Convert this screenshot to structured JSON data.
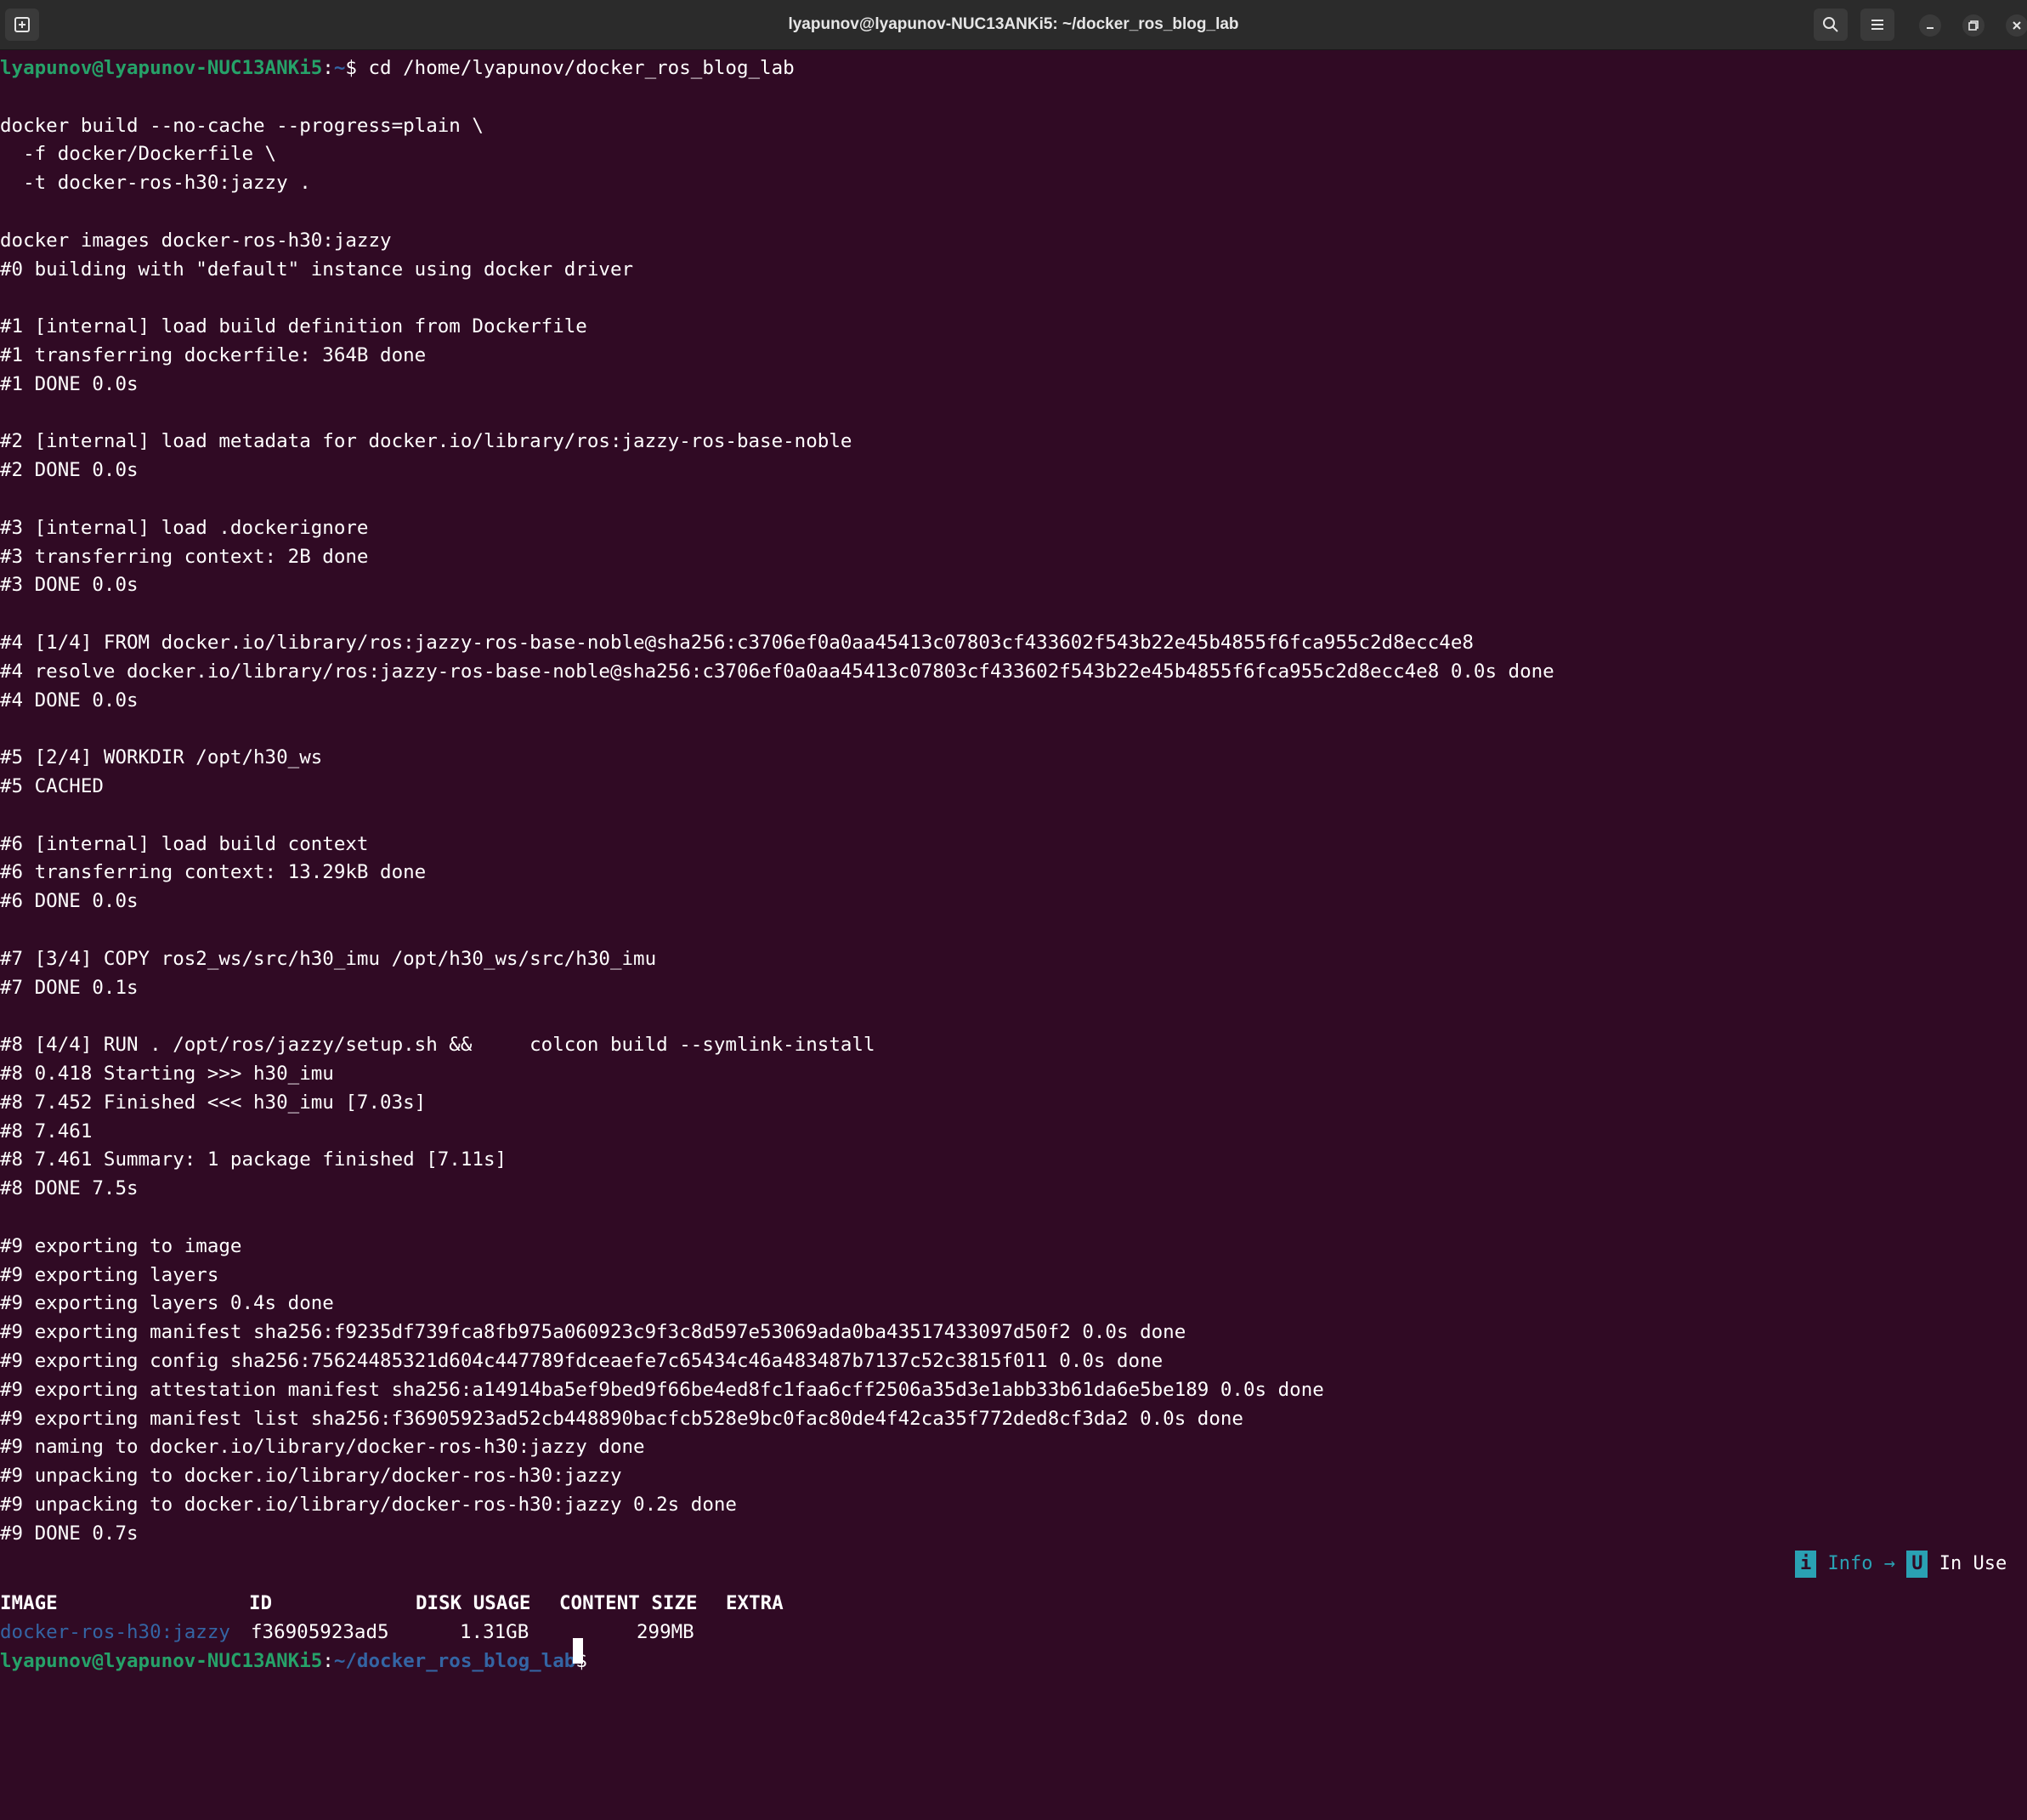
{
  "window": {
    "title": "lyapunov@lyapunov-NUC13ANKi5: ~/docker_ros_blog_lab",
    "icons": [
      "new-tab-icon",
      "search-icon",
      "hamburger-menu-icon",
      "minimize-icon",
      "restore-icon",
      "close-icon"
    ]
  },
  "prompt": {
    "user": "lyapunov@lyapunov-NUC13ANKi5",
    "sep": ":",
    "path_first": "~",
    "path_last": "~/docker_ros_blog_lab",
    "dollar": "$"
  },
  "lines": [
    {
      "row": 1,
      "text": " cd /home/lyapunov/docker_ros_blog_lab",
      "type": "prompt"
    },
    {
      "row": 3,
      "text": "docker build --no-cache --progress=plain \\"
    },
    {
      "row": 4,
      "text": "  -f docker/Dockerfile \\"
    },
    {
      "row": 5,
      "text": "  -t docker-ros-h30:jazzy ."
    },
    {
      "row": 7,
      "text": "docker images docker-ros-h30:jazzy"
    },
    {
      "row": 8,
      "text": "#0 building with \"default\" instance using docker driver"
    },
    {
      "row": 10,
      "text": "#1 [internal] load build definition from Dockerfile"
    },
    {
      "row": 11,
      "text": "#1 transferring dockerfile: 364B done"
    },
    {
      "row": 12,
      "text": "#1 DONE 0.0s"
    },
    {
      "row": 14,
      "text": "#2 [internal] load metadata for docker.io/library/ros:jazzy-ros-base-noble"
    },
    {
      "row": 15,
      "text": "#2 DONE 0.0s"
    },
    {
      "row": 17,
      "text": "#3 [internal] load .dockerignore"
    },
    {
      "row": 18,
      "text": "#3 transferring context: 2B done"
    },
    {
      "row": 19,
      "text": "#3 DONE 0.0s"
    },
    {
      "row": 21,
      "text": "#4 [1/4] FROM docker.io/library/ros:jazzy-ros-base-noble@sha256:c3706ef0a0aa45413c07803cf433602f543b22e45b4855f6fca955c2d8ecc4e8"
    },
    {
      "row": 22,
      "text": "#4 resolve docker.io/library/ros:jazzy-ros-base-noble@sha256:c3706ef0a0aa45413c07803cf433602f543b22e45b4855f6fca955c2d8ecc4e8 0.0s done"
    },
    {
      "row": 23,
      "text": "#4 DONE 0.0s"
    },
    {
      "row": 25,
      "text": "#5 [2/4] WORKDIR /opt/h30_ws"
    },
    {
      "row": 26,
      "text": "#5 CACHED"
    },
    {
      "row": 28,
      "text": "#6 [internal] load build context"
    },
    {
      "row": 29,
      "text": "#6 transferring context: 13.29kB done"
    },
    {
      "row": 30,
      "text": "#6 DONE 0.0s"
    },
    {
      "row": 32,
      "text": "#7 [3/4] COPY ros2_ws/src/h30_imu /opt/h30_ws/src/h30_imu"
    },
    {
      "row": 33,
      "text": "#7 DONE 0.1s"
    },
    {
      "row": 35,
      "text": "#8 [4/4] RUN . /opt/ros/jazzy/setup.sh &&     colcon build --symlink-install"
    },
    {
      "row": 36,
      "text": "#8 0.418 Starting >>> h30_imu"
    },
    {
      "row": 37,
      "text": "#8 7.452 Finished <<< h30_imu [7.03s]"
    },
    {
      "row": 38,
      "text": "#8 7.461"
    },
    {
      "row": 39,
      "text": "#8 7.461 Summary: 1 package finished [7.11s]"
    },
    {
      "row": 40,
      "text": "#8 DONE 7.5s"
    },
    {
      "row": 42,
      "text": "#9 exporting to image"
    },
    {
      "row": 43,
      "text": "#9 exporting layers"
    },
    {
      "row": 44,
      "text": "#9 exporting layers 0.4s done"
    },
    {
      "row": 45,
      "text": "#9 exporting manifest sha256:f9235df739fca8fb975a060923c9f3c8d597e53069ada0ba43517433097d50f2 0.0s done"
    },
    {
      "row": 46,
      "text": "#9 exporting config sha256:75624485321d604c447789fdceaefe7c65434c46a483487b7137c52c3815f011 0.0s done"
    },
    {
      "row": 47,
      "text": "#9 exporting attestation manifest sha256:a14914ba5ef9bed9f66be4ed8fc1faa6cff2506a35d3e1abb33b61da6e5be189 0.0s done"
    },
    {
      "row": 48,
      "text": "#9 exporting manifest list sha256:f36905923ad52cb448890bacfcb528e9bc0fac80de4f42ca35f772ded8cf3da2 0.0s done"
    },
    {
      "row": 49,
      "text": "#9 naming to docker.io/library/docker-ros-h30:jazzy done"
    },
    {
      "row": 50,
      "text": "#9 unpacking to docker.io/library/docker-ros-h30:jazzy"
    },
    {
      "row": 51,
      "text": "#9 unpacking to docker.io/library/docker-ros-h30:jazzy 0.2s done"
    },
    {
      "row": 52,
      "text": "#9 DONE 0.7s"
    }
  ],
  "images_table": {
    "headers": [
      "IMAGE",
      "ID",
      "DISK USAGE",
      "CONTENT SIZE",
      "EXTRA"
    ],
    "row": [
      "docker-ros-h30:jazzy",
      "f36905923ad5",
      "1.31GB",
      "299MB",
      ""
    ]
  },
  "legend": {
    "info_badge": "i",
    "info_label": "Info",
    "arrow": "→",
    "inuse_badge": "U",
    "inuse_label": "In Use"
  },
  "colors": {
    "background": "#300a24",
    "prompt_user": "#26a269",
    "prompt_path": "#3465a4",
    "legend_accent": "#2aa1b3"
  }
}
